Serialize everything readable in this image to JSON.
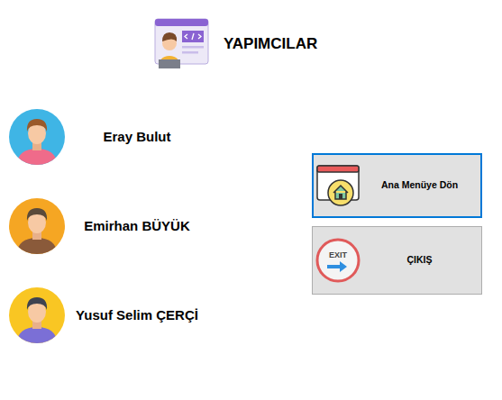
{
  "title": "YAPIMCILAR",
  "people": [
    {
      "name": "Eray Bulut",
      "color": "#3fb5e5"
    },
    {
      "name": "Emirhan BÜYÜK",
      "color": "#f5a623"
    },
    {
      "name": "Yusuf Selim ÇERÇİ",
      "color": "#f9c623"
    }
  ],
  "buttons": [
    {
      "label": "Ana Menüye Dön",
      "selected": true,
      "kind": "home"
    },
    {
      "label": "ÇIKIŞ",
      "selected": false,
      "kind": "exit",
      "icon_text": "EXIT"
    }
  ]
}
